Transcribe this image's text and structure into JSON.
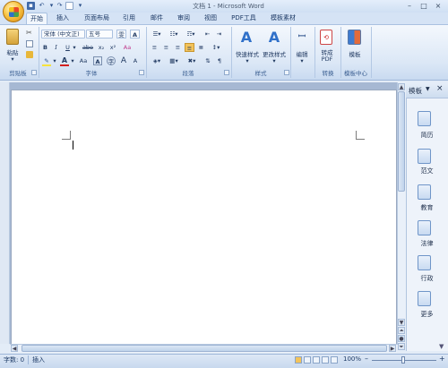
{
  "window": {
    "title": "文档 1 - Microsoft Word",
    "minimize_glyph": "–",
    "restore_glyph": "□",
    "close_glyph": "×"
  },
  "quick_access": {
    "save_icon": "save-icon",
    "undo_glyph": "↶",
    "redo_glyph": "↷",
    "more_glyph": "▾"
  },
  "tabs": [
    {
      "label": "开始"
    },
    {
      "label": "插入"
    },
    {
      "label": "页面布局"
    },
    {
      "label": "引用"
    },
    {
      "label": "邮件"
    },
    {
      "label": "审阅"
    },
    {
      "label": "视图"
    },
    {
      "label": "PDF工具"
    },
    {
      "label": "模板素材"
    }
  ],
  "ribbon": {
    "clipboard": {
      "paste_label": "粘贴",
      "group_label": "剪贴板"
    },
    "font": {
      "font_name": "宋体 (中文正)",
      "font_size": "五号",
      "bold": "B",
      "italic": "I",
      "underline": "U",
      "strike": "abe",
      "subscript": "x₂",
      "superscript": "x²",
      "clear": "Aa",
      "grow": "A",
      "shrink": "A",
      "color_a": "A",
      "change_case": "Aa",
      "char_border": "A",
      "enclose": "字",
      "group_label": "字体",
      "highlight_color": "#f7e23c",
      "font_color": "#d2201f"
    },
    "paragraph": {
      "group_label": "段落"
    },
    "styles": {
      "quick_styles": "快速样式",
      "change_styles": "更改样式",
      "group_label": "样式"
    },
    "editing": {
      "label": "编辑"
    },
    "convert": {
      "label_line1": "转成",
      "label_line2": "PDF",
      "group_label": "转换"
    },
    "template": {
      "label": "模板",
      "group_label": "模板中心"
    }
  },
  "task_pane": {
    "title": "模板",
    "dropdown_glyph": "▼",
    "close_glyph": "×",
    "items": [
      {
        "label": "简历",
        "icon": "resume-icon"
      },
      {
        "label": "范文",
        "icon": "sample-essay-icon"
      },
      {
        "label": "教育",
        "icon": "education-icon"
      },
      {
        "label": "法律",
        "icon": "law-icon"
      },
      {
        "label": "行政",
        "icon": "administration-icon"
      },
      {
        "label": "更多",
        "icon": "more-icon"
      }
    ]
  },
  "status_bar": {
    "word_count": "字数: 0",
    "insert_mode": "插入",
    "zoom": "100%",
    "zoom_minus": "–",
    "zoom_plus": "+"
  },
  "colors": {
    "accent": "#2f70c9",
    "ribbon_bg": "#dbe7f6",
    "doc_bg": "#a6b8d3"
  }
}
